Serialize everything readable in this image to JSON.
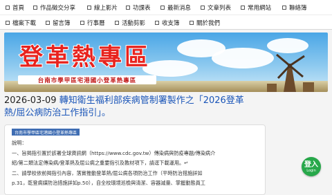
{
  "nav": {
    "row1": [
      "首頁",
      "作品徵交分享",
      "線上影片",
      "功課表",
      "最新消息",
      "文章列表",
      "常用網站",
      "聯絡簿"
    ],
    "row2": [
      "檔案下載",
      "留言簿",
      "行事曆",
      "活動剪影",
      "收支簿",
      "關於我們"
    ]
  },
  "banner": {
    "title": "登革熱專區",
    "subtitle": "台南市學甲區宅港國小登革熱專區"
  },
  "post": {
    "date": "2026-03-09",
    "title": "轉知衛生福利部疾病管制署製作之「2026登革熱/屈公病防治工作指引」。"
  },
  "card": {
    "chip": "台南市學甲區宅港國小登革熱專區",
    "heading": "說明：",
    "line1": "一、旨揭指引置於該署全球資訊網（https://www.cdc.gov.tw）傳染病與防疫專題/傳染病介",
    "line2": "紹/第二類法定傳染病/登革熱及屈公病之重要指引及教材項下，請逕下載運用。↵",
    "line3": "二、請學校依前揭指引內容，落實推動登革熱/屈公病各項防治工作（平時防治措施詳如",
    "line4": "p.31，乾登病媒防治措施詳如p.50），自全校環境巡檢與清潔、容器減量、掌握動態員工"
  },
  "login": {
    "big": "登入",
    "small": "Login"
  },
  "colors": {
    "accent_red": "#e8231e",
    "link_blue": "#1a55b8",
    "login_green": "#27a84a",
    "chip_blue": "#3f6db3"
  }
}
